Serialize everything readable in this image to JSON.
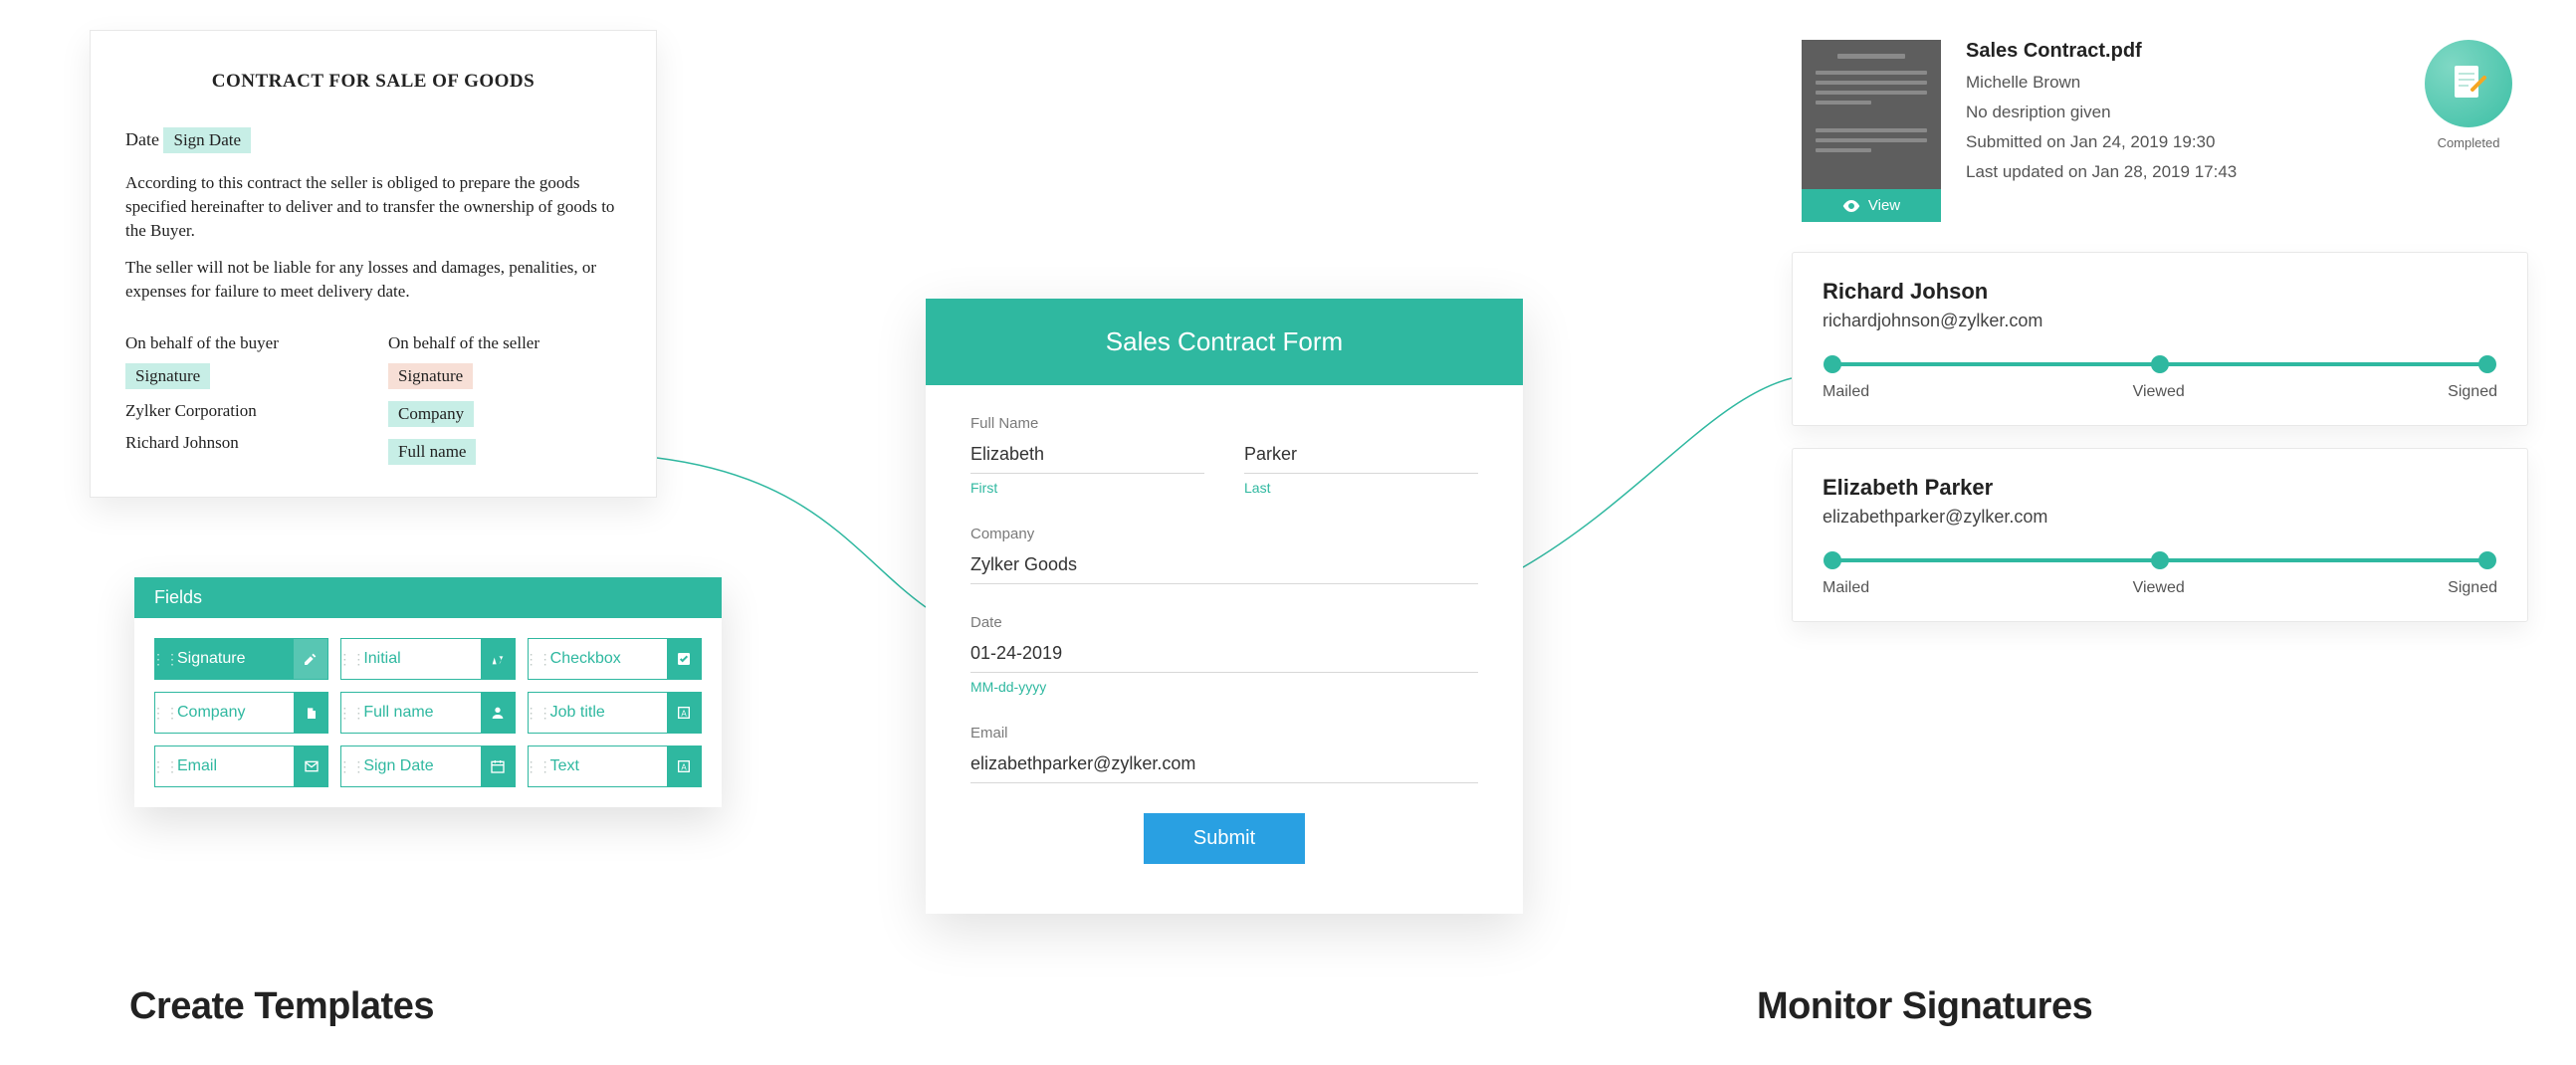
{
  "template": {
    "title": "CONTRACT FOR SALE OF GOODS",
    "date_label": "Date",
    "date_tag": "Sign Date",
    "p1": "According to this contract the seller is obliged to prepare the goods specified hereinafter to deliver and to transfer the ownership of goods to the Buyer.",
    "p2": "The seller will not be liable for any losses and damages, penalities, or expenses for failure to meet delivery date.",
    "buyer": {
      "label": "On behalf of the buyer",
      "signature": "Signature",
      "company": "Zylker Corporation",
      "name": "Richard Johnson"
    },
    "seller": {
      "label": "On behalf of the seller",
      "signature": "Signature",
      "company": "Company",
      "name": "Full name"
    }
  },
  "palette": {
    "title": "Fields",
    "items": [
      {
        "label": "Signature",
        "icon": "signature",
        "active": true
      },
      {
        "label": "Initial",
        "icon": "initial"
      },
      {
        "label": "Checkbox",
        "icon": "checkbox"
      },
      {
        "label": "Company",
        "icon": "company"
      },
      {
        "label": "Full name",
        "icon": "fullname"
      },
      {
        "label": "Job title",
        "icon": "jobtitle"
      },
      {
        "label": "Email",
        "icon": "email"
      },
      {
        "label": "Sign Date",
        "icon": "date"
      },
      {
        "label": "Text",
        "icon": "text"
      }
    ]
  },
  "form": {
    "title": "Sales Contract Form",
    "full_name_label": "Full Name",
    "first_value": "Elizabeth",
    "first_hint": "First",
    "last_value": "Parker",
    "last_hint": "Last",
    "company_label": "Company",
    "company_value": "Zylker Goods",
    "date_label": "Date",
    "date_value": "01-24-2019",
    "date_hint": "MM-dd-yyyy",
    "email_label": "Email",
    "email_value": "elizabethparker@zylker.com",
    "submit": "Submit"
  },
  "monitor": {
    "doc": {
      "title": "Sales Contract.pdf",
      "owner": "Michelle Brown",
      "desc": "No desription given",
      "submitted": "Submitted on Jan 24, 2019 19:30",
      "updated": "Last updated on Jan 28, 2019 17:43",
      "view": "View",
      "completed": "Completed"
    },
    "track_labels": {
      "mailed": "Mailed",
      "viewed": "Viewed",
      "signed": "Signed"
    },
    "signers": [
      {
        "name": "Richard Johson",
        "email": "richardjohnson@zylker.com"
      },
      {
        "name": "Elizabeth Parker",
        "email": "elizabethparker@zylker.com"
      }
    ]
  },
  "headings": {
    "left": "Create Templates",
    "right": "Monitor Signatures"
  }
}
